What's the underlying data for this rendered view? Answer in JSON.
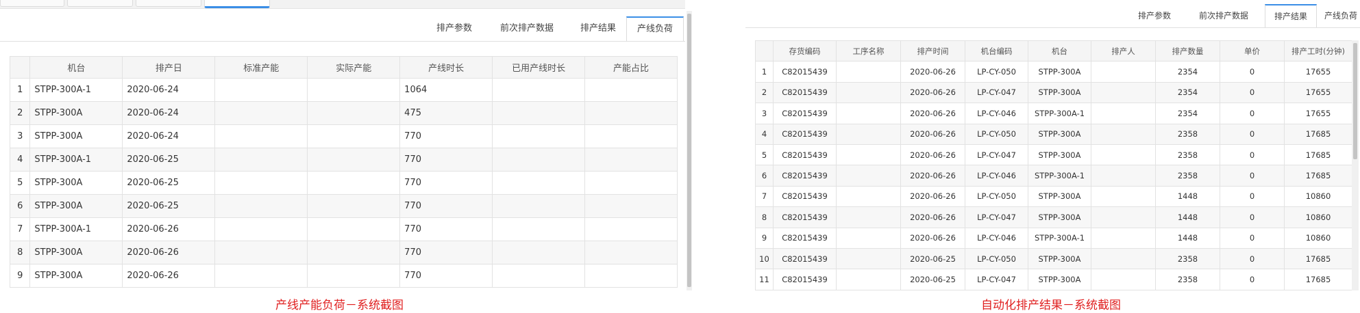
{
  "left": {
    "tabs": [
      "排产参数",
      "前次排产数据",
      "排产结果",
      "产线负荷"
    ],
    "active_tab": 3,
    "columns": [
      "",
      "机台",
      "排产日",
      "标准产能",
      "实际产能",
      "产线时长",
      "已用产线时长",
      "产能占比"
    ],
    "rows": [
      [
        "1",
        "STPP-300A-1",
        "2020-06-24",
        "",
        "",
        "1064",
        "",
        ""
      ],
      [
        "2",
        "STPP-300A",
        "2020-06-24",
        "",
        "",
        "475",
        "",
        ""
      ],
      [
        "3",
        "STPP-300A",
        "2020-06-24",
        "",
        "",
        "770",
        "",
        ""
      ],
      [
        "4",
        "STPP-300A-1",
        "2020-06-25",
        "",
        "",
        "770",
        "",
        ""
      ],
      [
        "5",
        "STPP-300A",
        "2020-06-25",
        "",
        "",
        "770",
        "",
        ""
      ],
      [
        "6",
        "STPP-300A",
        "2020-06-25",
        "",
        "",
        "770",
        "",
        ""
      ],
      [
        "7",
        "STPP-300A-1",
        "2020-06-26",
        "",
        "",
        "770",
        "",
        ""
      ],
      [
        "8",
        "STPP-300A",
        "2020-06-26",
        "",
        "",
        "770",
        "",
        ""
      ],
      [
        "9",
        "STPP-300A",
        "2020-06-26",
        "",
        "",
        "770",
        "",
        ""
      ]
    ],
    "caption": "产线产能负荷－系统截图"
  },
  "right": {
    "tabs": [
      "排产参数",
      "前次排产数据",
      "排产结果",
      "产线负荷"
    ],
    "active_tab": 2,
    "columns": [
      "",
      "存货编码",
      "工序名称",
      "排产时间",
      "机台编码",
      "机台",
      "排产人",
      "排产数量",
      "单价",
      "排产工时(分钟)"
    ],
    "rows": [
      [
        "1",
        "C82015439",
        "",
        "2020-06-26",
        "LP-CY-050",
        "STPP-300A",
        "",
        "2354",
        "0",
        "17655"
      ],
      [
        "2",
        "C82015439",
        "",
        "2020-06-26",
        "LP-CY-047",
        "STPP-300A",
        "",
        "2354",
        "0",
        "17655"
      ],
      [
        "3",
        "C82015439",
        "",
        "2020-06-26",
        "LP-CY-046",
        "STPP-300A-1",
        "",
        "2354",
        "0",
        "17655"
      ],
      [
        "4",
        "C82015439",
        "",
        "2020-06-26",
        "LP-CY-050",
        "STPP-300A",
        "",
        "2358",
        "0",
        "17685"
      ],
      [
        "5",
        "C82015439",
        "",
        "2020-06-26",
        "LP-CY-047",
        "STPP-300A",
        "",
        "2358",
        "0",
        "17685"
      ],
      [
        "6",
        "C82015439",
        "",
        "2020-06-26",
        "LP-CY-046",
        "STPP-300A-1",
        "",
        "2358",
        "0",
        "17685"
      ],
      [
        "7",
        "C82015439",
        "",
        "2020-06-26",
        "LP-CY-050",
        "STPP-300A",
        "",
        "1448",
        "0",
        "10860"
      ],
      [
        "8",
        "C82015439",
        "",
        "2020-06-26",
        "LP-CY-047",
        "STPP-300A",
        "",
        "1448",
        "0",
        "10860"
      ],
      [
        "9",
        "C82015439",
        "",
        "2020-06-26",
        "LP-CY-046",
        "STPP-300A-1",
        "",
        "1448",
        "0",
        "10860"
      ],
      [
        "10",
        "C82015439",
        "",
        "2020-06-25",
        "LP-CY-050",
        "STPP-300A",
        "",
        "2358",
        "0",
        "17685"
      ],
      [
        "11",
        "C82015439",
        "",
        "2020-06-25",
        "LP-CY-047",
        "STPP-300A",
        "",
        "2358",
        "0",
        "17685"
      ]
    ],
    "caption": "自动化排产结果－系统截图"
  },
  "colors": {
    "accent": "#3a8ee6",
    "caption": "#e02020"
  }
}
